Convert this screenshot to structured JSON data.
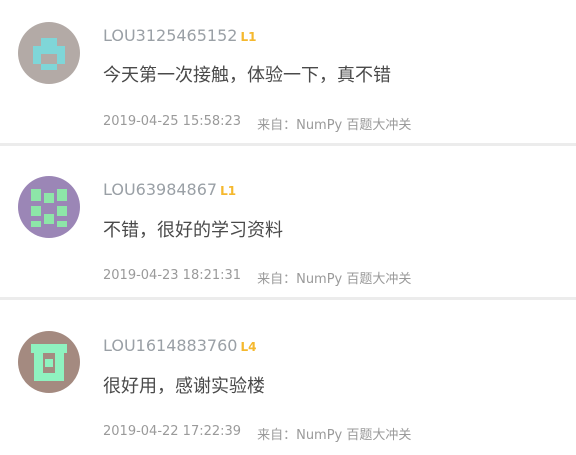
{
  "comments": [
    {
      "username": "LOU3125465152",
      "level": "L1",
      "content": "今天第一次接触，体验一下，真不错",
      "timestamp": "2019-04-25 15:58:23",
      "source_label": "来自：",
      "source_name": "NumPy 百题大冲关",
      "avatar": {
        "bg": "#b3aaa6",
        "fg": "#7fd6d8",
        "pattern": "avatar-1"
      }
    },
    {
      "username": "LOU63984867",
      "level": "L1",
      "content": "不错，很好的学习资料",
      "timestamp": "2019-04-23 18:21:31",
      "source_label": "来自：",
      "source_name": "NumPy 百题大冲关",
      "avatar": {
        "bg": "#9b86b6",
        "fg": "#8de6a8",
        "pattern": "avatar-2"
      }
    },
    {
      "username": "LOU1614883760",
      "level": "L4",
      "content": "很好用，感谢实验楼",
      "timestamp": "2019-04-22 17:22:39",
      "source_label": "来自：",
      "source_name": "NumPy 百题大冲关",
      "avatar": {
        "bg": "#a48a80",
        "fg": "#8ff2c0",
        "pattern": "avatar-3"
      }
    }
  ]
}
